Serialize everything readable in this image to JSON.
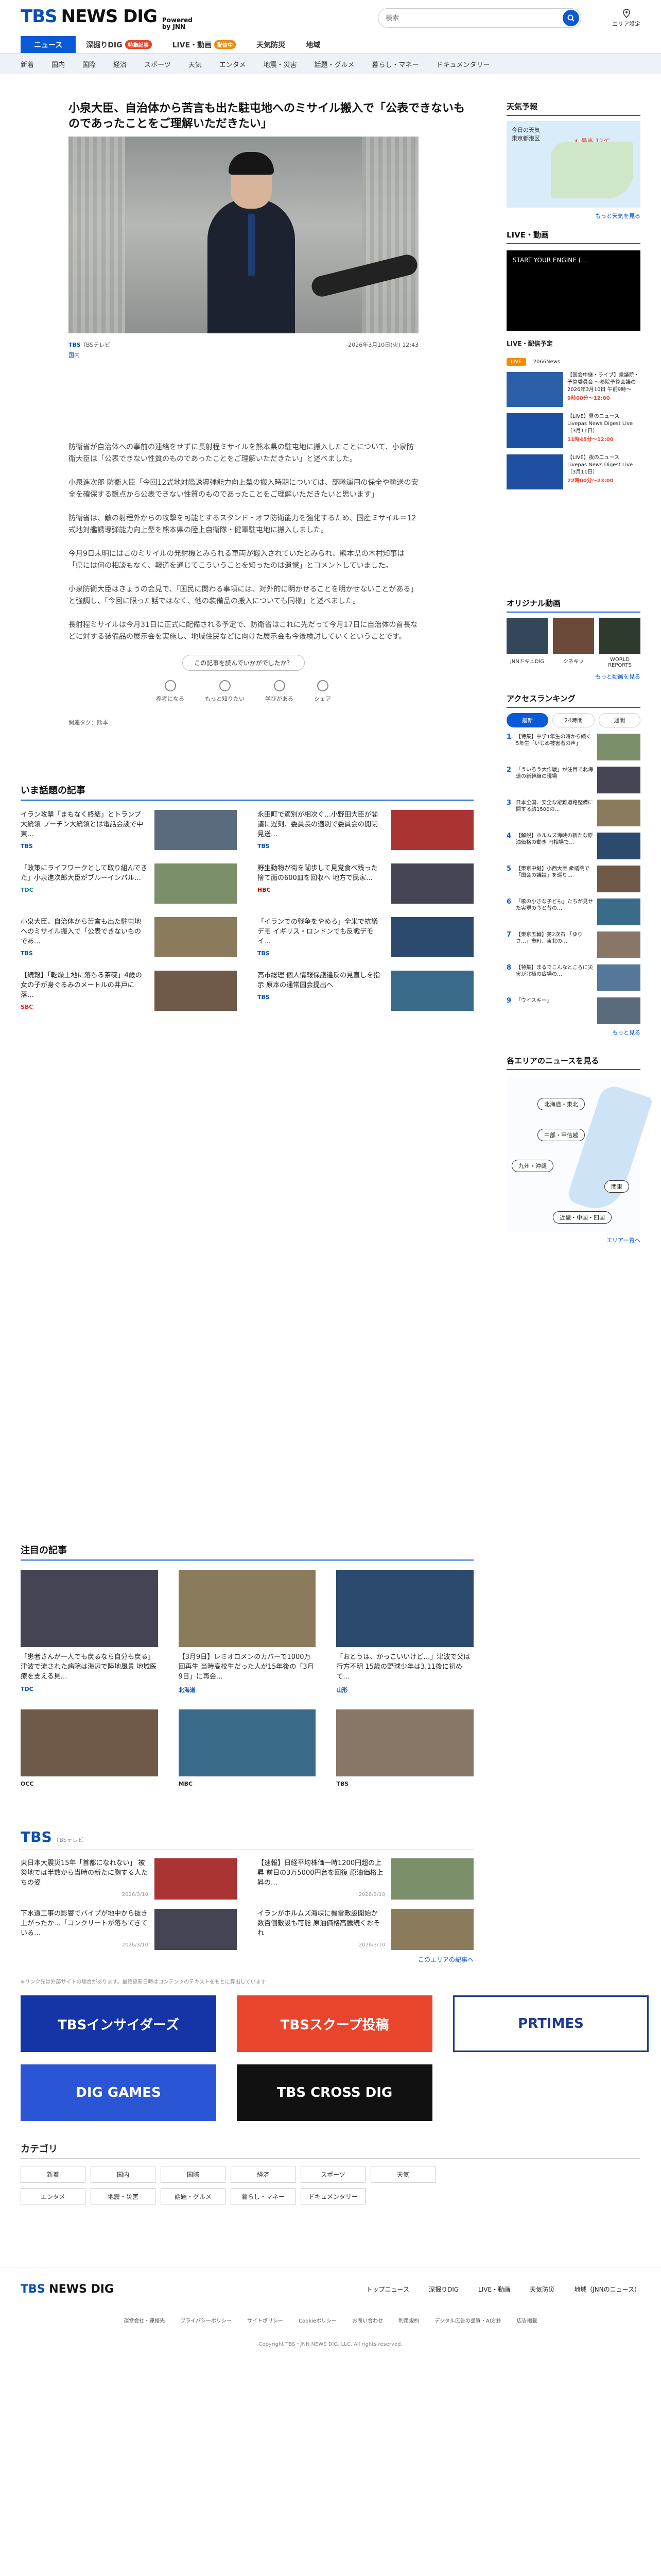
{
  "header": {
    "logo_tbs": "TBS",
    "logo_news": "NEWS DIG",
    "logo_powered": "Powered",
    "logo_by": "by JNN",
    "search_placeholder": "検索",
    "area_label": "エリア設定"
  },
  "nav_main": [
    {
      "label": "ニュース",
      "active": true
    },
    {
      "label": "深掘りDIG",
      "badge": "特集記事"
    },
    {
      "label": "LIVE・動画",
      "badge": "配信中"
    },
    {
      "label": "天気防災"
    },
    {
      "label": "地域"
    }
  ],
  "nav_sub": [
    "新着",
    "国内",
    "国際",
    "経済",
    "スポーツ",
    "天気",
    "エンタメ",
    "地震・災害",
    "話題・グルメ",
    "暮らし・マネー",
    "ドキュメンタリー"
  ],
  "article": {
    "title": "小泉大臣、自治体から苦言も出た駐屯地へのミサイル搬入で「公表できないものであったことをご理解いただきたい」",
    "source": "TBS",
    "source_sub": "TBSテレビ",
    "source_link": "国内",
    "date": "2026年3月10日(火) 12:43",
    "paragraphs": [
      "防衛省が自治体への事前の連絡をせずに長射程ミサイルを熊本県の駐屯地に搬入したことについて、小泉防衛大臣は「公表できない性質のものであったことをご理解いただきたい」と述べました。",
      "小泉進次郎 防衛大臣「今回12式地対艦誘導弾能力向上型の搬入時期については、部隊運用の保全や輸送の安全を確保する観点から公表できない性質のものであったことをご理解いただきたいと思います」",
      "防衛省は、敵の射程外からの攻撃を可能とするスタンド・オフ防衛能力を強化するため、国産ミサイル＝12式地対艦誘導弾能力向上型を熊本県の陸上自衛隊・健軍駐屯地に搬入しました。",
      "今月9日未明にはこのミサイルの発射機とみられる車両が搬入されていたとみられ、熊本県の木村知事は「県には何の相談もなく、報道を通じてこういうことを知ったのは遺憾」とコメントしていました。",
      "小泉防衛大臣はきょうの会見で、「国民に関わる事項には、対外的に明かせることを明かせないことがある」と強調し、「今回に限った話ではなく、他の装備品の搬入についても同様」と述べました。",
      "長射程ミサイルは今月31日に正式に配備される予定で、防衛省はこれに先だって今月17日に自治体の首長などに対する装備品の展示会を実施し、地域住民などに向けた展示会も今後検討していくということです。"
    ],
    "feedback_question": "この記事を読んでいかがでしたか？",
    "feedback_options": [
      "参考になる",
      "もっと知りたい",
      "学びがある",
      "シェア"
    ],
    "tags_label": "関連タグ：",
    "tag": "熊本"
  },
  "topics": {
    "title": "いま話題の記事",
    "items": [
      {
        "text": "イラン攻撃「まもなく終結」とトランプ大統領 プーチン大統領とは電話会談で中東…",
        "src": "TBS",
        "srcClass": "tbs-logo",
        "date": "10時間前"
      },
      {
        "text": "永田町で適別が相次ぐ…小野田大臣が閣議に遅刻、委員長の適別で委員会の開閉見送…",
        "src": "TBS",
        "srcClass": "tbs-logo",
        "date": "1時間前"
      },
      {
        "text": "「政策にライフワークとして取り組んできた」小泉進次郎大臣がブルーインパル…",
        "src": "TDC",
        "srcClass": "tdc",
        "date": "2026/3/9"
      },
      {
        "text": "野生動物が街を闊歩して見覚食べ残った捨て面の600皿を回収へ 地方で民家…",
        "src": "HBC",
        "srcClass": "hbc",
        "date": "2026/3/10"
      },
      {
        "text": "小泉大臣、自治体から苦言も出た駐屯地へのミサイル搬入で「公表できないものであ…",
        "src": "TBS",
        "srcClass": "tbs-logo",
        "date": "2026/3/10"
      },
      {
        "text": "「イランでの戦争をやめろ」全米で抗議デモ イギリス・ロンドンでも反戦デモ イ…",
        "src": "TBS",
        "srcClass": "tbs-logo",
        "date": "2026/3/9"
      },
      {
        "text": "【続報】「乾燥土地に落ちる茶碗」4歳の女の子が身ぐるみのメートルの井戸に落…",
        "src": "SBC",
        "srcClass": "sbc",
        "date": "2026/3/10"
      },
      {
        "text": "高市総理 個人情報保護違反の見直しを指示 原本の通常国会提出へ",
        "src": "TBS",
        "srcClass": "tbs-logo",
        "date": "2026/3/10"
      }
    ]
  },
  "notable": {
    "title": "注目の記事",
    "items": [
      {
        "text": "「患者さんが一人でも戻るなら自分も戻る」津波で流された病院は海辺で陸地風景 地域医療を支える見…",
        "src": "TDC",
        "date": "2026/3/10"
      },
      {
        "text": "【3月9日】レミオロメンのカバーで1000万回再生 当時高校生だった人が15年後の「3月9日」に再会…",
        "src": "北海道",
        "date": "2026/3/9"
      },
      {
        "text": "「おとうは、かっこいいけど…」津波で父は行方不明 15歳の野球少年は3.11後に初めて…",
        "src": "山形",
        "date": "2026/3/10"
      }
    ],
    "row2_srcs": [
      "OCC",
      "MBC",
      "TBS"
    ],
    "row2_dates": [
      "2026/3/10",
      "2026/3/9",
      "2026/3/10"
    ]
  },
  "tbs": {
    "logo": "TBS",
    "sub": "TBSテレビ",
    "items": [
      {
        "text": "東日本大震災15年「首都になれない」 被災地では半数から当時の新たに胸する人たちの姿",
        "date": "2026/3/10"
      },
      {
        "text": "【速報】日経平均株価一時1200円超の上昇 前日の3万5000円台を回復 原油価格上昇の…",
        "date": "2026/3/10"
      },
      {
        "text": "下水道工事の影響でパイプが地中から抜き上がったか…「コンクリートが落ちてきている…",
        "date": "2026/3/10"
      },
      {
        "text": "イランがホルムズ海峡に機雷敷設開始か 数百個敷設も可能 原油価格高騰続くおそれ",
        "date": "2026/3/10"
      }
    ],
    "more": "このエリアの記事へ"
  },
  "disclaimer": "※リンク先は外部サイトの場合があります。最終更新日時はコンテンツのテキストをもとに算出しています",
  "banners": [
    {
      "label": "TBSインサイダーズ",
      "bg": "#1535a6"
    },
    {
      "label": "TBSスクープ投稿",
      "bg": "#e8452c"
    },
    {
      "label": "PRTIMES",
      "bg": "#ffffff"
    },
    {
      "label": "DIG GAMES",
      "bg": "#2a56d6"
    },
    {
      "label": "TBS CROSS DIG",
      "bg": "#111111"
    }
  ],
  "categories": {
    "title": "カテゴリ",
    "items": [
      "新着",
      "国内",
      "国際",
      "経済",
      "スポーツ",
      "天気",
      "エンタメ",
      "地震・災害",
      "話題・グルメ",
      "暮らし・マネー",
      "ドキュメンタリー"
    ]
  },
  "sidebar": {
    "weather_title": "天気予報",
    "weather_today": "今日の天気",
    "weather_city": "東京都港区",
    "weather_temp": "最高 12℃",
    "weather_more": "もっと天気を見る",
    "live_title": "LIVE・動画",
    "player_text": "START YOUR ENGINE (…",
    "live_tab_label": "LIVE・配信予定",
    "live_tabs": [
      "LIVE",
      "2066News"
    ],
    "live_items": [
      {
        "text": "【国会中継・ライブ】衆議院・予算委員会 ～参院予算会議の2026年3月10日 午前9時～",
        "time": "9時00分～12:00"
      },
      {
        "text": "【LIVE】昼のニュース Livepas News Digest Live（3月11日）",
        "time": "11時45分～12:00"
      },
      {
        "text": "【LIVE】夜のニュース Livepas News Digest Live（3月11日）",
        "time": "22時00分～23:00"
      }
    ],
    "original_title": "オリジナル動画",
    "originals": [
      "JNNドキュDIG",
      "シネキッ",
      "WORLD REPORTS"
    ],
    "original_more": "もっと動画を見る",
    "ranking_title": "アクセスランキング",
    "ranking_tabs": [
      "最新",
      "24時間",
      "週間"
    ],
    "ranking": [
      "【特集】中学1年生の時から続く5年生「いじめ被害者の声」",
      "「ういろう大作戦」が注目で北海道の新幹線の現場",
      "日本全国、安全な避難道路整備に関する約1500の…",
      "【解説】ホルムズ海峡の新たな原油価格の動き 円相場で…",
      "【東京中継】小西大臣 衆議院で「国会の議論」を巡り…",
      "「歌の小さな子ども」たちが見せた実現の今と昔の…",
      "【東京五輪】第2次石 「ゆりさ…」市町、東北の…",
      "【特集】まるでこんなところに災害が北極の広場の…",
      "「ウイスキー」"
    ],
    "ranking_more": "もっと見る",
    "areas_title": "各エリアのニュースを見る",
    "area_pills": [
      "北海道・東北",
      "中部・甲信越",
      "九州・沖縄",
      "関東",
      "近畿・中国・四国"
    ],
    "areas_more": "エリア一覧へ"
  },
  "footer": {
    "logo_tbs": "TBS",
    "logo_news": "NEWS DIG",
    "nav": [
      "トップニュース",
      "深掘りDIG",
      "LIVE・動画",
      "天気防災",
      "地域（JNNのニュース）"
    ],
    "links": [
      "運営会社・連絡先",
      "プライバシーポリシー",
      "サイトポリシー",
      "Cookieポリシー",
      "お問い合わせ",
      "利用規約",
      "デジタル広告の品質・AI方針",
      "広告掲載"
    ],
    "copyright": "Copyright TBS・JNN NEWS DIG, LLC. All rights reserved."
  }
}
